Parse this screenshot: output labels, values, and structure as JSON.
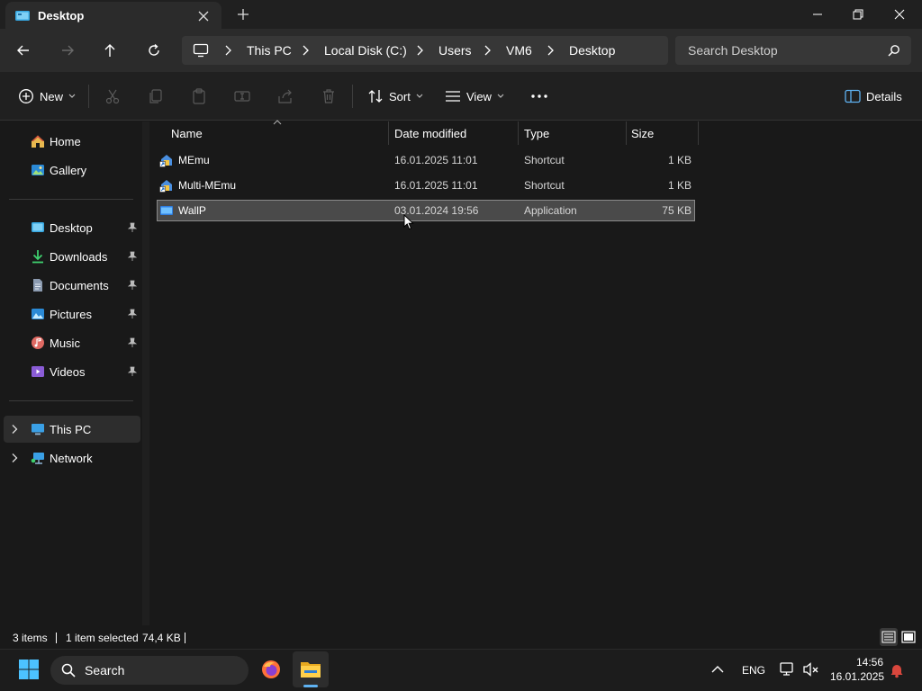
{
  "window": {
    "tab_title": "Desktop",
    "minimize_symbol": "—",
    "maximize_symbol": "❐",
    "close_symbol": "✕"
  },
  "navigation": {
    "breadcrumbs": [
      "This PC",
      "Local Disk (C:)",
      "Users",
      "VM6",
      "Desktop"
    ],
    "search_placeholder": "Search Desktop"
  },
  "commandbar": {
    "new_label": "New",
    "sort_label": "Sort",
    "view_label": "View",
    "details_label": "Details"
  },
  "sidebar": {
    "quick": [
      {
        "label": "Home",
        "icon": "home-icon"
      },
      {
        "label": "Gallery",
        "icon": "gallery-icon"
      }
    ],
    "pinned": [
      {
        "label": "Desktop",
        "icon": "desktop-folder-icon"
      },
      {
        "label": "Downloads",
        "icon": "downloads-icon"
      },
      {
        "label": "Documents",
        "icon": "documents-icon"
      },
      {
        "label": "Pictures",
        "icon": "pictures-icon"
      },
      {
        "label": "Music",
        "icon": "music-icon"
      },
      {
        "label": "Videos",
        "icon": "videos-icon"
      }
    ],
    "tree": [
      {
        "label": "This PC",
        "icon": "this-pc-icon",
        "selected": true
      },
      {
        "label": "Network",
        "icon": "network-icon",
        "selected": false
      }
    ]
  },
  "file_list": {
    "columns": [
      "Name",
      "Date modified",
      "Type",
      "Size"
    ],
    "rows": [
      {
        "name": "MEmu",
        "date": "16.01.2025 11:01",
        "type": "Shortcut",
        "size": "1 KB",
        "selected": false,
        "icon": "shortcut-icon"
      },
      {
        "name": "Multi-MEmu",
        "date": "16.01.2025 11:01",
        "type": "Shortcut",
        "size": "1 KB",
        "selected": false,
        "icon": "shortcut-icon"
      },
      {
        "name": "WallP",
        "date": "03.01.2024 19:56",
        "type": "Application",
        "size": "75 KB",
        "selected": true,
        "icon": "application-icon"
      }
    ]
  },
  "statusbar": {
    "item_count": "3 items",
    "selection": "1 item selected",
    "selection_size": "74,4 KB"
  },
  "taskbar": {
    "search_label": "Search",
    "language": "ENG",
    "time": "14:56",
    "date": "16.01.2025"
  },
  "colors": {
    "accent": "#5fb2f2",
    "selection_bg": "#4a4a4a",
    "window_bg": "#191919"
  }
}
